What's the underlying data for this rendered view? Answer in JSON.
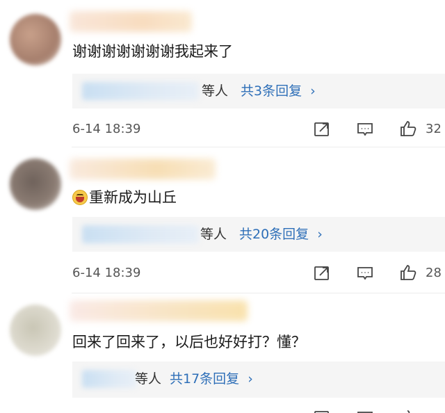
{
  "comments": [
    {
      "text": "谢谢谢谢谢谢谢我起来了",
      "emoji": "",
      "replies": {
        "who": "等人",
        "count": "共3条回复"
      },
      "date": "6-14 18:39",
      "likes": "32"
    },
    {
      "text": "重新成为山丘",
      "emoji": "laughing-crying-emoji",
      "replies": {
        "who": "等人",
        "count": "共20条回复"
      },
      "date": "6-14 18:39",
      "likes": "28"
    },
    {
      "text": "回来了回来了，以后也好好打？懂？",
      "emoji": "",
      "replies": {
        "who": "等人",
        "count": "共17条回复"
      },
      "date": "",
      "likes": ""
    }
  ],
  "icons": {
    "chevron": "›",
    "share": "share-icon",
    "comment": "comment-icon",
    "like": "thumbs-up-icon"
  },
  "colors": {
    "link": "#2e6fb8",
    "reply_bg": "#f5f5f5"
  }
}
